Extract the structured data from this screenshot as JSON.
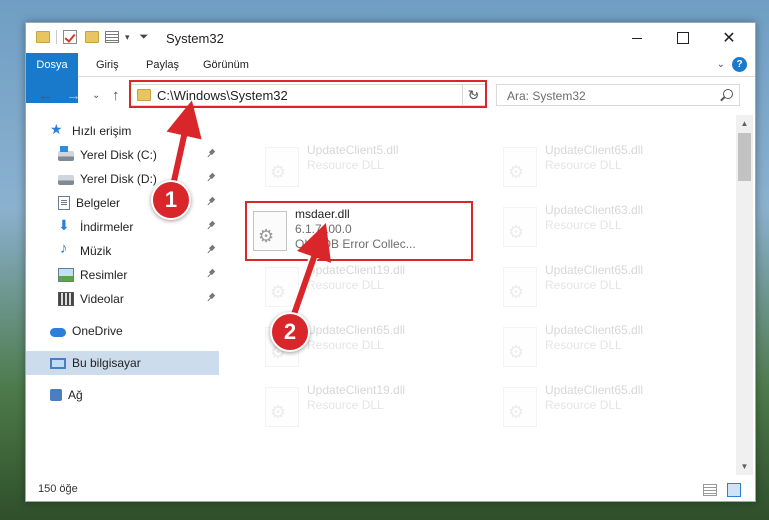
{
  "window": {
    "title": "System32",
    "ribbon_tabs": [
      "Dosya",
      "Giriş",
      "Paylaş",
      "Görünüm"
    ]
  },
  "navigation": {
    "address": "C:\\Windows\\System32",
    "search_placeholder": "Ara: System32"
  },
  "sidebar": {
    "items": [
      {
        "label": "Hızlı erişim",
        "icon": "star-icon"
      },
      {
        "label": "Yerel Disk (C:)",
        "icon": "drive-icon"
      },
      {
        "label": "Yerel Disk (D:)",
        "icon": "drive-icon"
      },
      {
        "label": "Belgeler",
        "icon": "document-icon"
      },
      {
        "label": "İndirmeler",
        "icon": "download-icon"
      },
      {
        "label": "Müzik",
        "icon": "music-icon"
      },
      {
        "label": "Resimler",
        "icon": "pictures-icon"
      },
      {
        "label": "Videolar",
        "icon": "video-icon"
      },
      {
        "label": "OneDrive",
        "icon": "cloud-icon"
      },
      {
        "label": "Bu bilgisayar",
        "icon": "computer-icon"
      },
      {
        "label": "Ağ",
        "icon": "network-icon"
      }
    ]
  },
  "files": {
    "highlighted": {
      "name": "msdaer.dll",
      "version": "6.1.7100.0",
      "description": "OLE DB Error Collec..."
    },
    "faded": [
      {
        "name": "UpdateClient5.dll",
        "description": "Resource DLL"
      },
      {
        "name": "UpdateClient65.dll",
        "description": "Resource DLL"
      },
      {
        "name": "UpdateClient63.dll",
        "description": "Resource DLL"
      },
      {
        "name": "UpdateClient19.dll",
        "description": "Resource DLL"
      },
      {
        "name": "UpdateClient65.dll",
        "description": "Resource DLL"
      },
      {
        "name": "UpdateClient65.dll",
        "description": "Resource DLL"
      },
      {
        "name": "UpdateClient65.dll",
        "description": "Resource DLL"
      },
      {
        "name": "UpdateClient19.dll",
        "description": "Resource DLL"
      },
      {
        "name": "UpdateClient65.dll",
        "description": "Resource DLL"
      }
    ]
  },
  "status": {
    "item_count": "150 öğe"
  },
  "annotations": {
    "step1": "1",
    "step2": "2"
  }
}
